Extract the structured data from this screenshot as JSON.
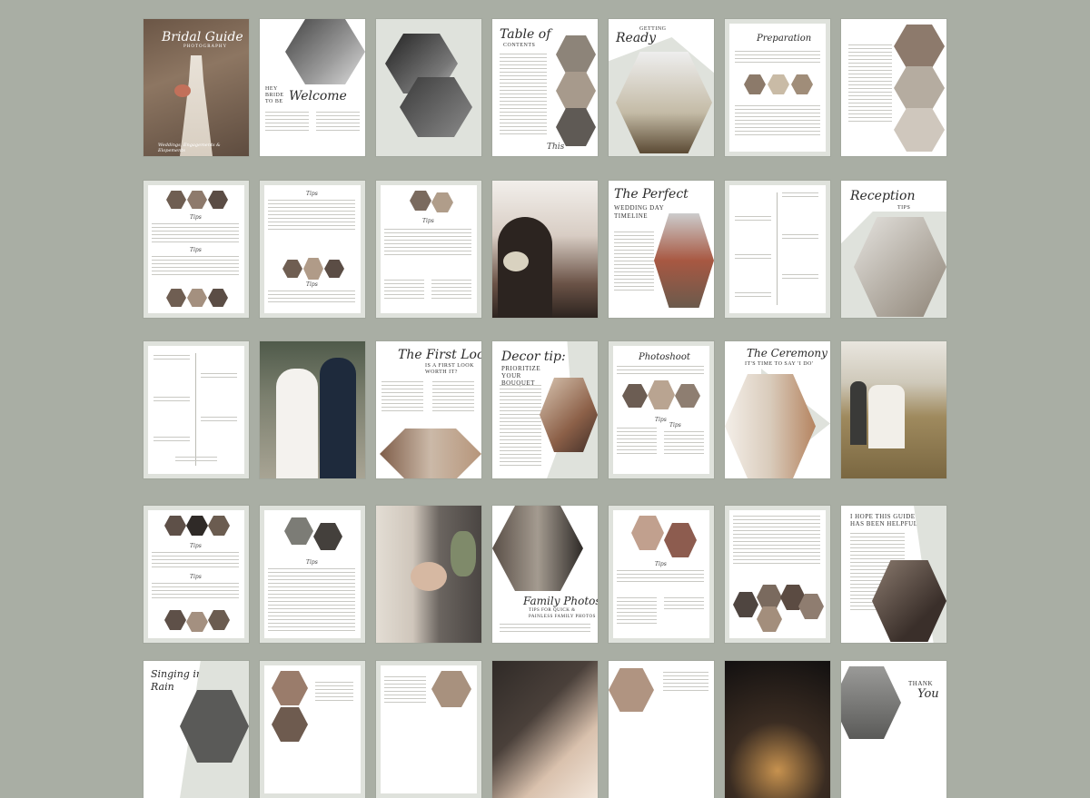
{
  "colors": {
    "background": "#a9aea4",
    "sage": "#dfe2dc",
    "ink": "#2b2b2b"
  },
  "pages": {
    "p1": {
      "title": "Bridal Guide",
      "sub": "PHOTOGRAPHY",
      "foot": "Weddings, Engagements & Elopements"
    },
    "p2": {
      "lead": "HEY BRIDE TO BE",
      "title": "Welcome"
    },
    "p4": {
      "title": "Table of",
      "sub": "CONTENTS",
      "sign": "This"
    },
    "p5": {
      "sub": "GETTING",
      "title": "Ready"
    },
    "p6": {
      "title": "Preparation"
    },
    "p8": {
      "tip": "Tips",
      "tip2": "Tips"
    },
    "p9": {
      "tip": "Tips",
      "tip2": "Tips"
    },
    "p10": {
      "tip": "Tips"
    },
    "p12": {
      "title": "The Perfect",
      "sub": "WEDDING DAY TIMELINE"
    },
    "p14": {
      "title": "Reception",
      "sub": "TIPS"
    },
    "p17": {
      "title": "The First Look",
      "sub": "IS A FIRST LOOK WORTH IT?"
    },
    "p18": {
      "title": "Decor tip:",
      "sub": "PRIORITIZE YOUR BOUQUET"
    },
    "p19": {
      "title": "Photoshoot",
      "tip": "Tips",
      "tip2": "Tips"
    },
    "p20": {
      "title": "The Ceremony",
      "sub": "IT'S TIME TO SAY 'I DO'"
    },
    "p22": {
      "tip": "Tips",
      "tip2": "Tips"
    },
    "p23": {
      "tip": "Tips"
    },
    "p25": {
      "title": "Family Photos",
      "sub": "TIPS FOR QUICK & PAINLESS FAMILY PHOTOS"
    },
    "p26": {
      "tip": "Tips"
    },
    "p28": {
      "sub": "I HOPE THIS GUIDE HAS BEEN HELPFUL"
    },
    "p29": {
      "title": "Singing in the Rain"
    },
    "p35": {
      "sub": "THANK",
      "title": "You"
    }
  }
}
